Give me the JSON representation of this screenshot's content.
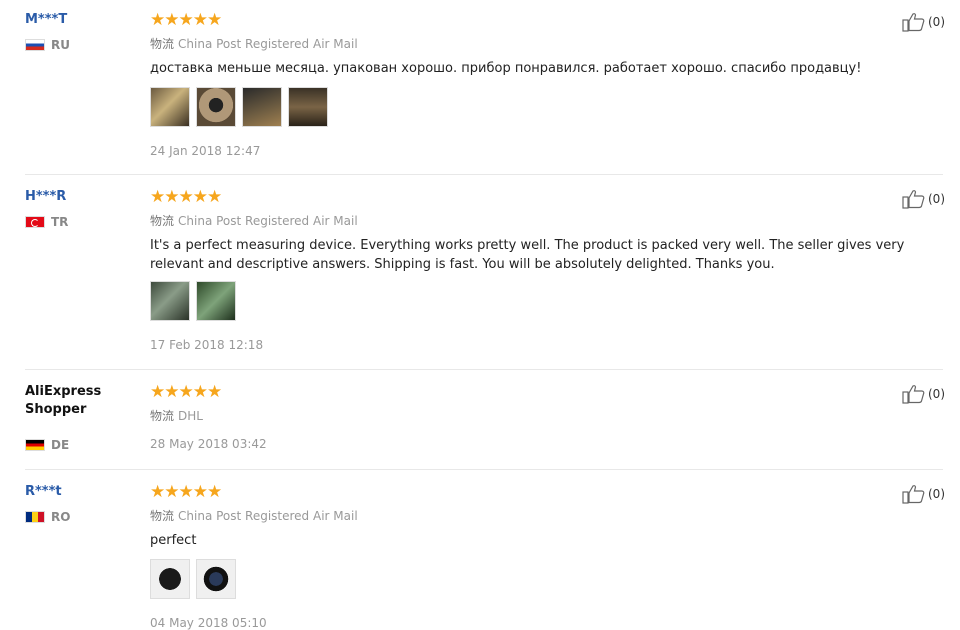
{
  "reviews": [
    {
      "user": "M***T",
      "country": "RU",
      "rating_stars": 5,
      "shipping_cn": "物流",
      "shipping": "China Post Registered Air Mail",
      "text": "доставка меньше месяца. упакован хорошо. прибор понравился. работает хорошо. спасибо продавцу!",
      "photo_count": 4,
      "date": "24 Jan 2018 12:47",
      "likes": "(0)"
    },
    {
      "user": "H***R",
      "country": "TR",
      "rating_stars": 5,
      "shipping_cn": "物流",
      "shipping": "China Post Registered Air Mail",
      "text": "It's a perfect measuring device. Everything works pretty well. The product is packed very well. The seller gives very relevant and descriptive answers. Shipping is fast. You will be absolutely delighted. Thanks you.",
      "photo_count": 2,
      "date": "17 Feb 2018 12:18",
      "likes": "(0)"
    },
    {
      "user": "AliExpress Shopper",
      "country": "DE",
      "rating_stars": 5,
      "shipping_cn": "物流",
      "shipping": "DHL",
      "date": "28 May 2018 03:42",
      "likes": "(0)"
    },
    {
      "user": "R***t",
      "country": "RO",
      "rating_stars": 5,
      "shipping_cn": "物流",
      "shipping": "China Post Registered Air Mail",
      "text": "perfect",
      "photo_count": 2,
      "date": "04 May 2018 05:10",
      "likes": "(0)"
    }
  ],
  "colors": {
    "username": "#2a5ba8",
    "star": "#f6a61d",
    "muted": "#999999"
  },
  "icons": {
    "like": "thumbs-up-icon",
    "rating": "star-icon"
  }
}
